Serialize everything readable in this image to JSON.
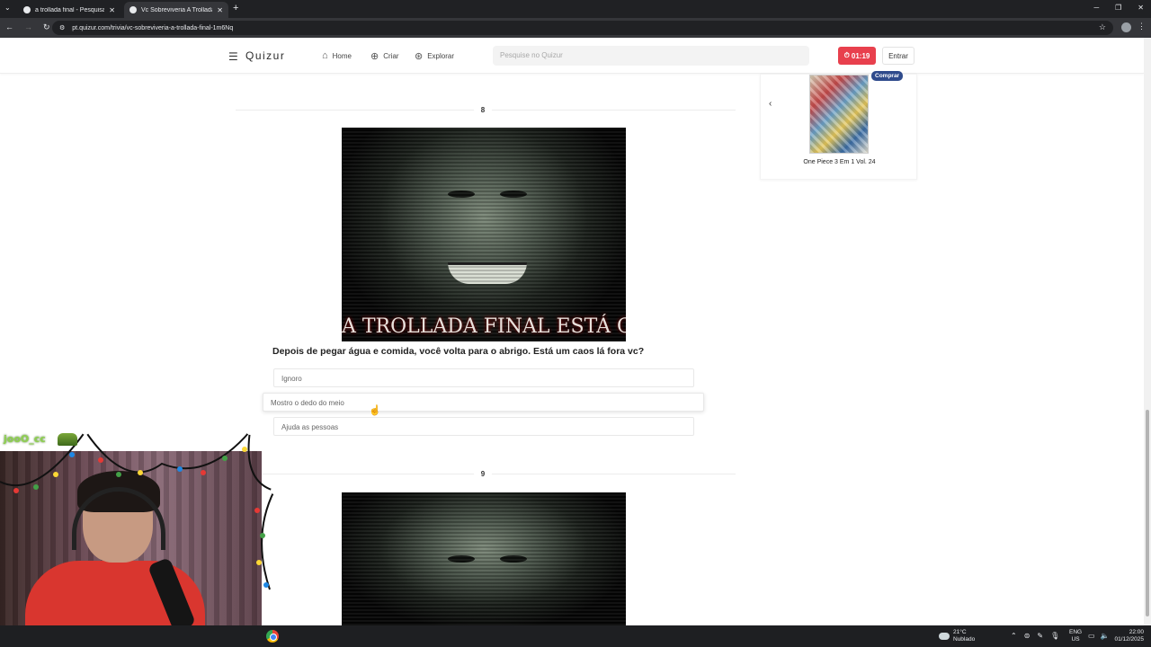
{
  "browser": {
    "tabs": [
      {
        "title": "a trollada final - Pesquisa Google"
      },
      {
        "title": "Vc Sobreviveria A Trollada Final"
      }
    ],
    "url": "pt.quizur.com/trivia/vc-sobreviveria-a-trollada-final-1m6Nq"
  },
  "header": {
    "logo": "Quizur",
    "nav": [
      {
        "label": "Home",
        "icon": "home-icon"
      },
      {
        "label": "Criar",
        "icon": "plus-circle-icon"
      },
      {
        "label": "Explorar",
        "icon": "compass-icon"
      }
    ],
    "search_placeholder": "Pesquise no Quizur",
    "timer": "01:19",
    "login_label": "Entrar"
  },
  "quiz": {
    "questions": [
      {
        "number": "8",
        "image_caption": "A TROLLADA FINAL ESTÁ CHEGANDO",
        "text": "Depois de pegar água e comida, você volta para o abrigo. Está um caos lá fora vc?",
        "options": [
          "Ignoro",
          "Mostro o dedo do meio",
          "Ajuda as pessoas"
        ]
      },
      {
        "number": "9"
      }
    ]
  },
  "sidebar_ad": {
    "badge": "Comprar",
    "product_title": "One Piece 3 Em 1 Vol. 24",
    "prev_icon": "chevron-left-icon"
  },
  "stream_overlay": {
    "username": "jooO_cc"
  },
  "taskbar": {
    "temperature": "21°C",
    "weather": "Nublado",
    "lang_top": "ENG",
    "lang_bottom": "US",
    "time": "22:00",
    "date": "01/12/2025"
  },
  "colors": {
    "accent_red": "#e8404d",
    "badge_blue": "#2f4b8c"
  }
}
